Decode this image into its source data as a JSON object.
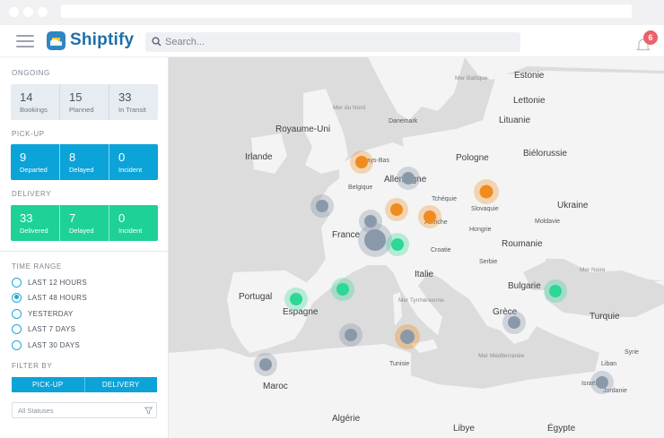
{
  "app": {
    "name": "Shiptify",
    "brand_color": "#1e6fa8"
  },
  "header": {
    "search_placeholder": "Search...",
    "notification_count": "6",
    "icons": [
      "menu-icon",
      "search-icon",
      "bell-icon"
    ]
  },
  "sidebar": {
    "ongoing": {
      "label": "ONGOING",
      "stats": [
        {
          "value": "14",
          "label": "Bookings"
        },
        {
          "value": "15",
          "label": "Planned"
        },
        {
          "value": "33",
          "label": "In Transit"
        }
      ]
    },
    "pickup": {
      "label": "PICK-UP",
      "color": "#0ba3d8",
      "stats": [
        {
          "value": "9",
          "label": "Departed"
        },
        {
          "value": "8",
          "label": "Delayed"
        },
        {
          "value": "0",
          "label": "Incident"
        }
      ]
    },
    "delivery": {
      "label": "DELIVERY",
      "color": "#1dd197",
      "stats": [
        {
          "value": "33",
          "label": "Delivered"
        },
        {
          "value": "7",
          "label": "Delayed"
        },
        {
          "value": "0",
          "label": "Incident"
        }
      ]
    },
    "time_range": {
      "label": "TIME RANGE",
      "options": [
        "LAST 12 HOURS",
        "LAST 48 HOURS",
        "YESTERDAY",
        "LAST 7 DAYS",
        "LAST 30 DAYS"
      ],
      "selected": "LAST 48 HOURS"
    },
    "filter": {
      "label": "FILTER BY",
      "buttons": [
        "PICK-UP",
        "DELIVERY"
      ],
      "status_select": "All Statuses"
    }
  },
  "map": {
    "labels": {
      "estonie": "Estonie",
      "lettonie": "Lettonie",
      "lituanie": "Lituanie",
      "royaume_uni": "Royaume-Uni",
      "danemark": "Danemark",
      "irlande": "Irlande",
      "pays_bas": "Pays-Bas",
      "pologne": "Pologne",
      "bielorussie": "Biélorussie",
      "belgique": "Belgique",
      "allemagne": "Allemagne",
      "tcheque": "Tchéquie",
      "slovaquie": "Slovaquie",
      "ukraine": "Ukraine",
      "moldavie": "Moldavie",
      "autriche": "Autriche",
      "hongrie": "Hongrie",
      "france": "France",
      "roumanie": "Roumanie",
      "croatie": "Croatie",
      "serbie": "Serbie",
      "italie": "Italie",
      "bulgarie": "Bulgarie",
      "portugal": "Portugal",
      "espagne": "Espagne",
      "grece": "Grèce",
      "turquie": "Turquie",
      "tunisie": "Tunisie",
      "syrie": "Syrie",
      "liban": "Liban",
      "israel": "Israël",
      "jordanie": "Jordanie",
      "maroc": "Maroc",
      "algerie": "Algérie",
      "libye": "Libye",
      "egypte": "Égypte",
      "mer_du_nord": "Mer du Nord",
      "mer_baltique": "Mer Baltique",
      "mer_noire": "Mer Noire",
      "mer_tyrrhenienne": "Mer Tyrrhénienne",
      "mer_mediterranee": "Mer Méditerranée"
    },
    "marker_colors": {
      "pickup": "#f08c1e",
      "delivery": "#2bd896",
      "inactive": "#8a99aa"
    }
  }
}
